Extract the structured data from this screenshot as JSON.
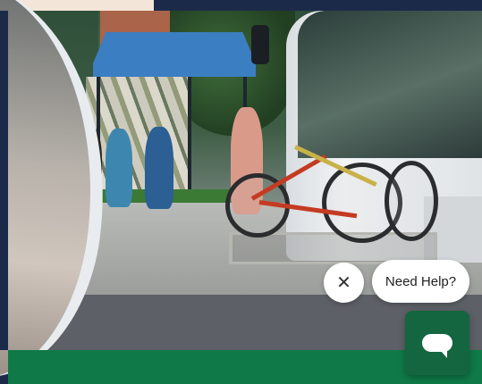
{
  "help_widget": {
    "prompt_label": "Need Help?",
    "close_glyph": "✕",
    "close_icon": "close-icon",
    "chat_icon": "chat-bubble-icon",
    "chat_button_color": "#13663f"
  },
  "colors": {
    "accent_green": "#0f7a48",
    "navy": "#1c2a4a",
    "top_strip": "#f3e6d8"
  }
}
